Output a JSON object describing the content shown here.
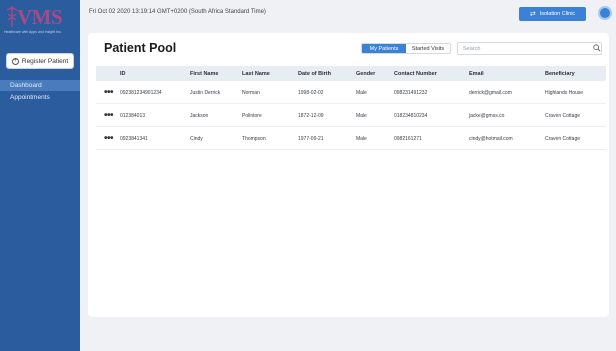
{
  "app": {
    "logo_text": "VMS",
    "logo_tagline": "Healthcare with Apps and Insight Inc.",
    "brand_color": "#a64a8a",
    "accent": "#3b82d6",
    "sidebar_color": "#2b5c9e"
  },
  "sidebar": {
    "register_label": "Register Patient",
    "items": [
      {
        "label": "Dashboard",
        "active": true
      },
      {
        "label": "Appointments",
        "active": false
      }
    ]
  },
  "topbar": {
    "datetime": "Fri Oct 02 2020 13:19:14 GMT+0200 (South Africa Standard Time)",
    "clinic_label": "Isolation Clinic"
  },
  "main": {
    "title": "Patient Pool",
    "tabs": [
      {
        "label": "My Patients",
        "active": true
      },
      {
        "label": "Started Visits",
        "active": false
      }
    ],
    "search_placeholder": "Search",
    "table": {
      "columns": [
        "ID",
        "First Name",
        "Last Name",
        "Date of Birth",
        "Gender",
        "Contact Number",
        "Email",
        "Beneficiary"
      ],
      "rows": [
        {
          "action": "•••",
          "cells": [
            "092381234901234",
            "Justin Derrick",
            "Norman",
            "1998-02-02",
            "Male",
            "098231491232",
            "derrick@gmail.com",
            "Highlands House"
          ]
        },
        {
          "action": "•••",
          "cells": [
            "012384013",
            "Jackson",
            "Polintore",
            "1872-12-09",
            "Male",
            "018234810234",
            "jacke@gmss.co",
            "Craven Cottage"
          ]
        },
        {
          "action": "•••",
          "cells": [
            "0923841341",
            "Cindy",
            "Thompson",
            "1977-09-21",
            "Male",
            "0982161271",
            "cindy@hotmail.com",
            "Craven Cottage"
          ]
        }
      ]
    }
  }
}
